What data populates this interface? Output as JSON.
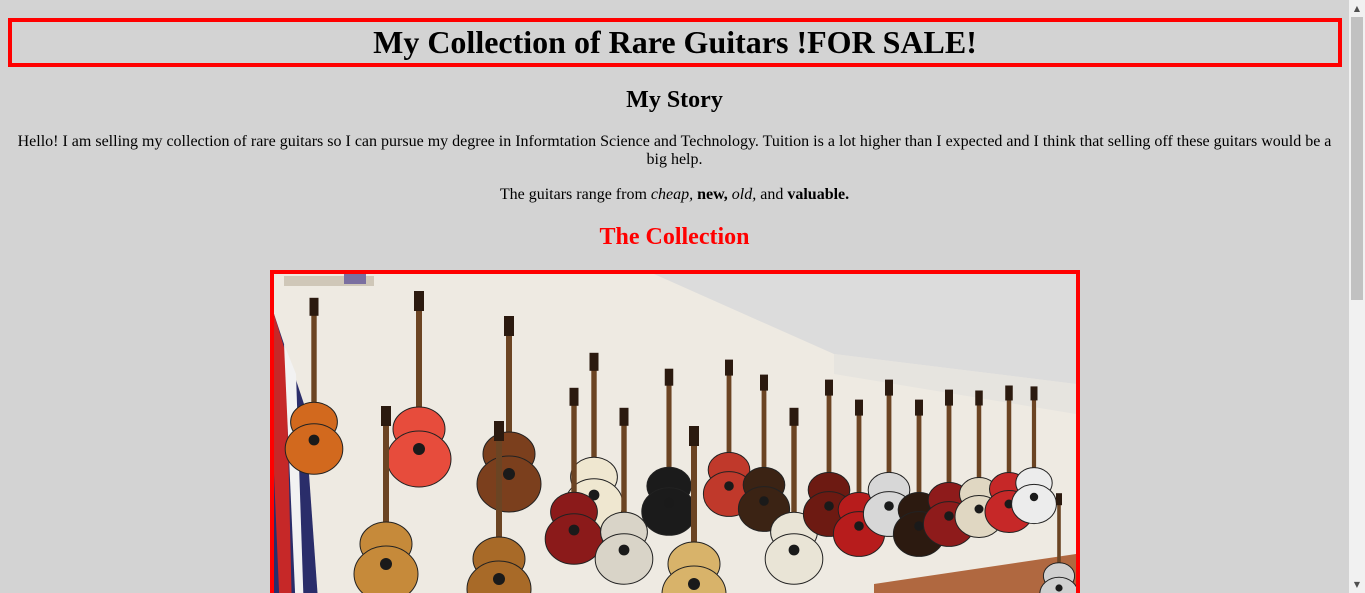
{
  "header": {
    "title": "My Collection of Rare Guitars !FOR SALE!"
  },
  "story": {
    "heading": "My Story",
    "paragraph": "Hello! I am selling my collection of rare guitars so I can pursue my degree in Informtation Science and Technology. Tuition is a lot higher than I expected and I think that selling off these guitars would be a big help.",
    "range_prefix": "The guitars range from ",
    "range_cheap": "cheap,",
    "range_new": "new,",
    "range_old": "old,",
    "range_and": " and ",
    "range_valuable": "valuable."
  },
  "collection": {
    "heading": "The Collection"
  },
  "colors": {
    "background": "#d3d3d3",
    "accent": "#ff0000"
  },
  "icons": {
    "scroll_up": "▲",
    "scroll_down": "▼"
  }
}
